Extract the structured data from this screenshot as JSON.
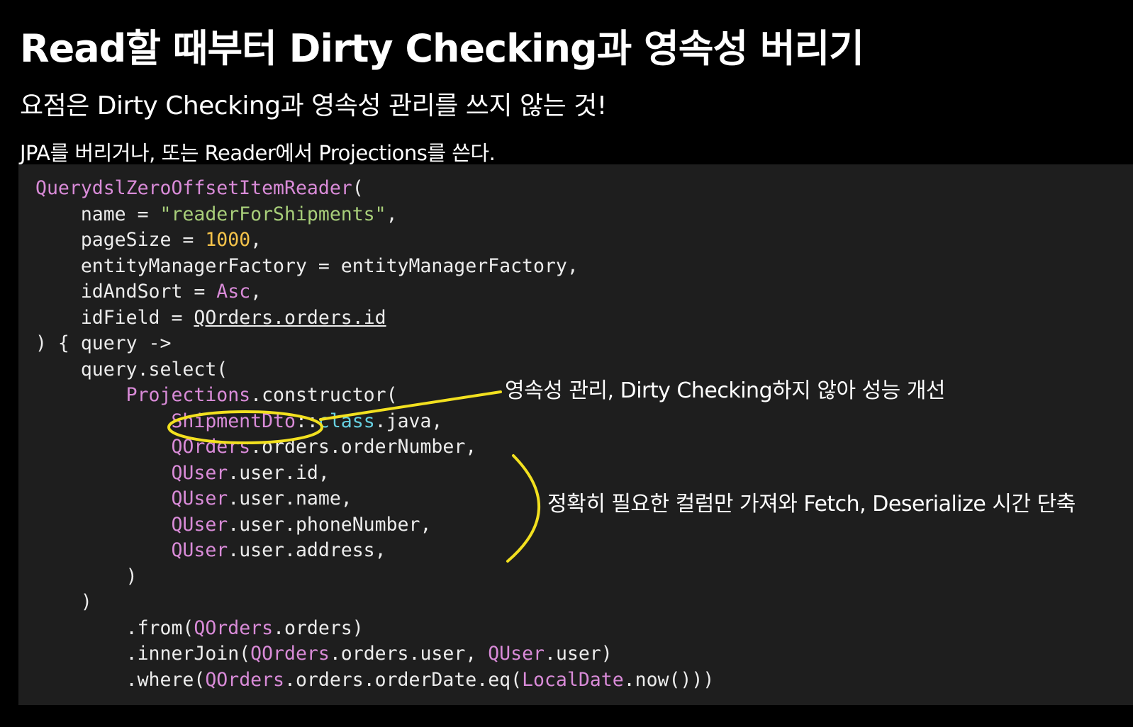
{
  "slide": {
    "title": "Read할 때부터 Dirty Checking과 영속성 버리기",
    "subtitle": "요점은 Dirty Checking과 영속성 관리를 쓰지 않는 것!",
    "note": "JPA를 버리거나, 또는 Reader에서 Projections를 쓴다."
  },
  "code": {
    "l1_fn": "QuerydslZeroOffsetItemReader",
    "l1_rest": "(",
    "l2_a": "    name = ",
    "l2_str": "\"readerForShipments\"",
    "l2_b": ",",
    "l3_a": "    pageSize = ",
    "l3_num": "1000",
    "l3_b": ",",
    "l4": "    entityManagerFactory = entityManagerFactory,",
    "l5_a": "    idAndSort = ",
    "l5_k": "Asc",
    "l5_b": ",",
    "l6_a": "    idField = ",
    "l6_u": "QOrders.orders.id",
    "l7": ") { query ->",
    "l8": "    query.select(",
    "l9_a": "        ",
    "l9_k": "Projections",
    "l9_b": ".constructor(",
    "l10_a": "            ",
    "l10_k": "ShipmentDto",
    "l10_b": "::",
    "l10_c": "class",
    "l10_d": ".java,",
    "l11_a": "            ",
    "l11_k": "QOrders",
    "l11_b": ".orders.orderNumber,",
    "l12_a": "            ",
    "l12_k": "QUser",
    "l12_b": ".user.id,",
    "l13_a": "            ",
    "l13_k": "QUser",
    "l13_b": ".user.name,",
    "l14_a": "            ",
    "l14_k": "QUser",
    "l14_b": ".user.phoneNumber,",
    "l15_a": "            ",
    "l15_k": "QUser",
    "l15_b": ".user.address,",
    "l16": "        )",
    "l17": "    )",
    "l18_a": "        .from(",
    "l18_k": "QOrders",
    "l18_b": ".orders)",
    "l19_a": "        .innerJoin(",
    "l19_k": "QOrders",
    "l19_b": ".orders.user, ",
    "l19_k2": "QUser",
    "l19_c": ".user)",
    "l20_a": "        .where(",
    "l20_k": "QOrders",
    "l20_b": ".orders.orderDate.eq(",
    "l20_k2": "LocalDate",
    "l20_c": ".now()))"
  },
  "annotations": {
    "persistence": "영속성 관리, Dirty Checking하지 않아 성능 개선",
    "columns": "정확히 필요한 컬럼만 가져와 Fetch, Deserialize 시간 단축"
  },
  "colors": {
    "background": "#000000",
    "code_panel": "#1e1e1e",
    "keyword": "#d98bd8",
    "string": "#a8cf7a",
    "number": "#f5c34a",
    "class_kw": "#66cfe0",
    "highlight": "#f2e01f"
  }
}
